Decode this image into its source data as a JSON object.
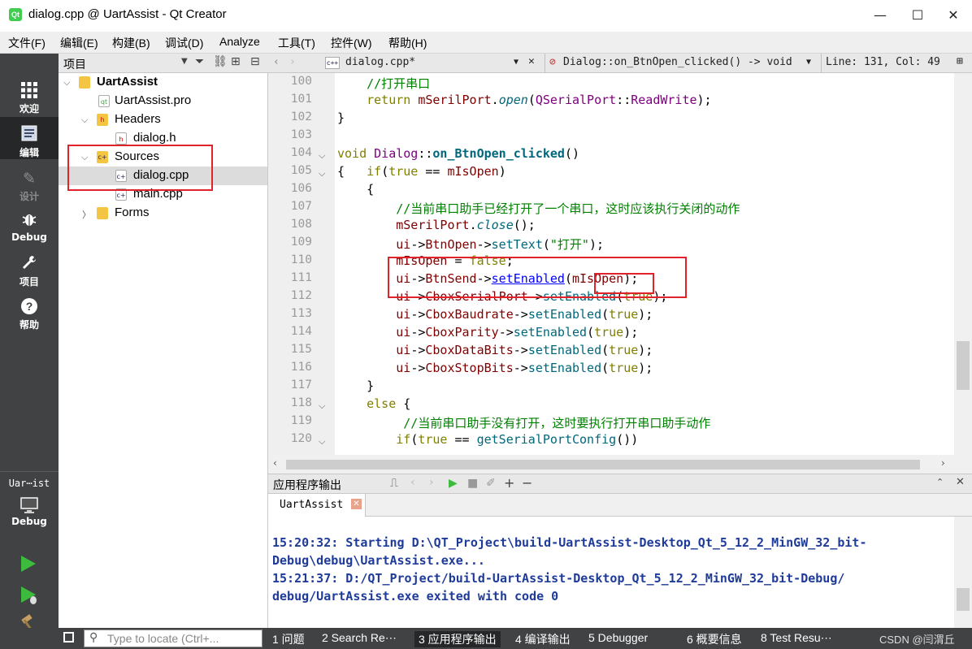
{
  "window": {
    "title": "dialog.cpp @ UartAssist - Qt Creator",
    "app_icon": "Qt",
    "min": "—",
    "max": "☐",
    "close": "✕"
  },
  "menu": [
    "文件(F)",
    "编辑(E)",
    "构建(B)",
    "调试(D)",
    "Analyze",
    "工具(T)",
    "控件(W)",
    "帮助(H)"
  ],
  "modes": [
    {
      "label": "欢迎",
      "icon": "grid-icon"
    },
    {
      "label": "编辑",
      "icon": "edit-icon"
    },
    {
      "label": "设计",
      "icon": "pencil-icon"
    },
    {
      "label": "Debug",
      "icon": "bug-icon"
    },
    {
      "label": "项目",
      "icon": "wrench-icon"
    },
    {
      "label": "帮助",
      "icon": "help-icon"
    }
  ],
  "kit": {
    "name": "Uar⋯ist",
    "mode": "Debug"
  },
  "project_panel": {
    "title": "项目"
  },
  "tree": {
    "root": "UartAssist",
    "pro": "UartAssist.pro",
    "headers": "Headers",
    "dialog_h": "dialog.h",
    "sources": "Sources",
    "dialog_cpp": "dialog.cpp",
    "main_cpp": "main.cpp",
    "forms": "Forms"
  },
  "editor": {
    "file": "dialog.cpp*",
    "function": "Dialog::on_BtnOpen_clicked() -> void",
    "position": "Line: 131, Col: 49"
  },
  "line_numbers": [
    "100",
    "101",
    "102",
    "103",
    "104",
    "105",
    "106",
    "107",
    "108",
    "109",
    "110",
    "111",
    "112",
    "113",
    "114",
    "115",
    "116",
    "117",
    "118",
    "119",
    "120"
  ],
  "output": {
    "panel_title": "应用程序输出",
    "tab": "UartAssist",
    "lines": [
      "15:20:32: Starting D:\\QT_Project\\build-UartAssist-Desktop_Qt_5_12_2_MinGW_32_bit-",
      "Debug\\debug\\UartAssist.exe...",
      "15:21:37: D:/QT_Project/build-UartAssist-Desktop_Qt_5_12_2_MinGW_32_bit-Debug/",
      "debug/UartAssist.exe exited with code 0"
    ]
  },
  "statusbar": {
    "locator_placeholder": "Type to locate (Ctrl+...",
    "tabs": [
      "1 问题",
      "2 Search Re⋯",
      "3 应用程序输出",
      "4 编译输出",
      "5 Debugger",
      "6 概要信息",
      "8 Test Resu⋯"
    ],
    "watermark": "CSDN @闫渭丘"
  }
}
